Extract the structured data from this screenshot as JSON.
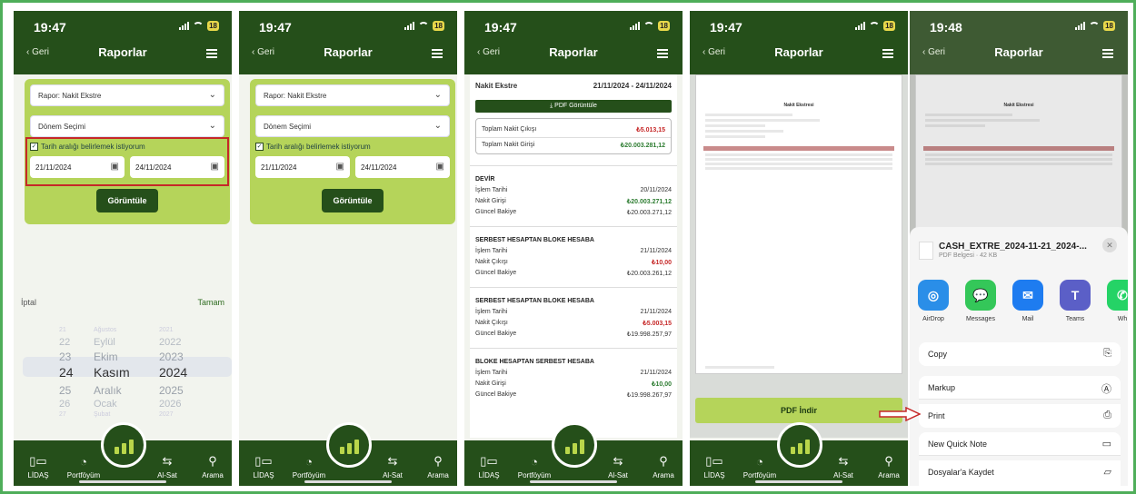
{
  "screens": [
    {
      "status": {
        "time": "19:47",
        "battery": "18"
      },
      "header": {
        "back": "Geri",
        "title": "Raporlar"
      },
      "form": {
        "report": "Rapor: Nakit Ekstre",
        "period": "Dönem Seçimi",
        "checkbox_label": "Tarih aralığı belirlemek istiyorum",
        "date_from": "21/11/2024",
        "date_to": "24/11/2024",
        "button": "Görüntüle"
      },
      "picker": {
        "cancel": "İptal",
        "done": "Tamam",
        "rows": [
          {
            "day": "21",
            "month": "Ağustos",
            "year": "2021"
          },
          {
            "day": "22",
            "month": "Eylül",
            "year": "2022"
          },
          {
            "day": "23",
            "month": "Ekim",
            "year": "2023"
          },
          {
            "day": "24",
            "month": "Kasım",
            "year": "2024"
          },
          {
            "day": "25",
            "month": "Aralık",
            "year": "2025"
          },
          {
            "day": "26",
            "month": "Ocak",
            "year": "2026"
          },
          {
            "day": "27",
            "month": "Şubat",
            "year": "2027"
          }
        ]
      }
    },
    {
      "status": {
        "time": "19:47",
        "battery": "18"
      },
      "header": {
        "back": "Geri",
        "title": "Raporlar"
      },
      "form": {
        "report": "Rapor: Nakit Ekstre",
        "period": "Dönem Seçimi",
        "checkbox_label": "Tarih aralığı belirlemek istiyorum",
        "date_from": "21/11/2024",
        "date_to": "24/11/2024",
        "button": "Görüntüle"
      }
    },
    {
      "status": {
        "time": "19:47",
        "battery": "18"
      },
      "header": {
        "back": "Geri",
        "title": "Raporlar"
      },
      "statement": {
        "title": "Nakit Ekstre",
        "range": "21/11/2024 - 24/11/2024",
        "pdf_view": "PDF Görüntüle",
        "total_out_label": "Toplam Nakit Çıkışı",
        "total_out": "₺5.013,15",
        "total_in_label": "Toplam Nakit Girişi",
        "total_in": "₺20.003.281,12",
        "sections": [
          {
            "title": "DEVİR",
            "rows": [
              {
                "label": "İşlem Tarihi",
                "value": "20/11/2024",
                "tone": "plain"
              },
              {
                "label": "Nakit Girişi",
                "value": "₺20.003.271,12",
                "tone": "green"
              },
              {
                "label": "Güncel Bakiye",
                "value": "₺20.003.271,12",
                "tone": "plain"
              }
            ]
          },
          {
            "title": "SERBEST HESAPTAN BLOKE HESABA",
            "rows": [
              {
                "label": "İşlem Tarihi",
                "value": "21/11/2024",
                "tone": "plain"
              },
              {
                "label": "Nakit Çıkışı",
                "value": "₺10,00",
                "tone": "red"
              },
              {
                "label": "Güncel Bakiye",
                "value": "₺20.003.261,12",
                "tone": "plain"
              }
            ]
          },
          {
            "title": "SERBEST HESAPTAN BLOKE HESABA",
            "rows": [
              {
                "label": "İşlem Tarihi",
                "value": "21/11/2024",
                "tone": "plain"
              },
              {
                "label": "Nakit Çıkışı",
                "value": "₺5.003,15",
                "tone": "red"
              },
              {
                "label": "Güncel Bakiye",
                "value": "₺19.998.257,97",
                "tone": "plain"
              }
            ]
          },
          {
            "title": "BLOKE HESAPTAN SERBEST HESABA",
            "rows": [
              {
                "label": "İşlem Tarihi",
                "value": "21/11/2024",
                "tone": "plain"
              },
              {
                "label": "Nakit Girişi",
                "value": "₺10,00",
                "tone": "green"
              },
              {
                "label": "Güncel Bakiye",
                "value": "₺19.998.267,97",
                "tone": "plain"
              }
            ]
          }
        ]
      }
    },
    {
      "status": {
        "time": "19:47",
        "battery": "18"
      },
      "header": {
        "back": "Geri",
        "title": "Raporlar"
      },
      "pdf": {
        "doc_title": "Nakit Ekstresi",
        "download": "PDF İndir"
      }
    },
    {
      "status": {
        "time": "19:48",
        "battery": "18"
      },
      "header": {
        "back": "Geri",
        "title": "Raporlar"
      },
      "pdf": {
        "doc_title": "Nakit Ekstresi"
      },
      "share": {
        "file_name": "CASH_EXTRE_2024-11-21_2024-...",
        "file_meta": "PDF Belgesi · 42 KB",
        "apps": [
          {
            "name": "AirDrop",
            "icon": "airdrop-icon",
            "color": "#2a8ee8"
          },
          {
            "name": "Messages",
            "icon": "messages-icon",
            "color": "#34c759"
          },
          {
            "name": "Mail",
            "icon": "mail-icon",
            "color": "#1e7cf0"
          },
          {
            "name": "Teams",
            "icon": "teams-icon",
            "color": "#5b5fc7"
          },
          {
            "name": "Wh",
            "icon": "whatsapp-icon",
            "color": "#25d366"
          }
        ],
        "actions": [
          "Copy",
          "Markup",
          "Print",
          "New Quick Note",
          "Dosyalar'a Kaydet"
        ]
      }
    }
  ],
  "nav": [
    "LİDAŞ",
    "Portföyüm",
    "Al-Sat",
    "Arama"
  ],
  "colors": {
    "primary": "#254f1a",
    "accent": "#b5d45a",
    "frame": "#4fae5a",
    "highlight": "#c62828"
  }
}
